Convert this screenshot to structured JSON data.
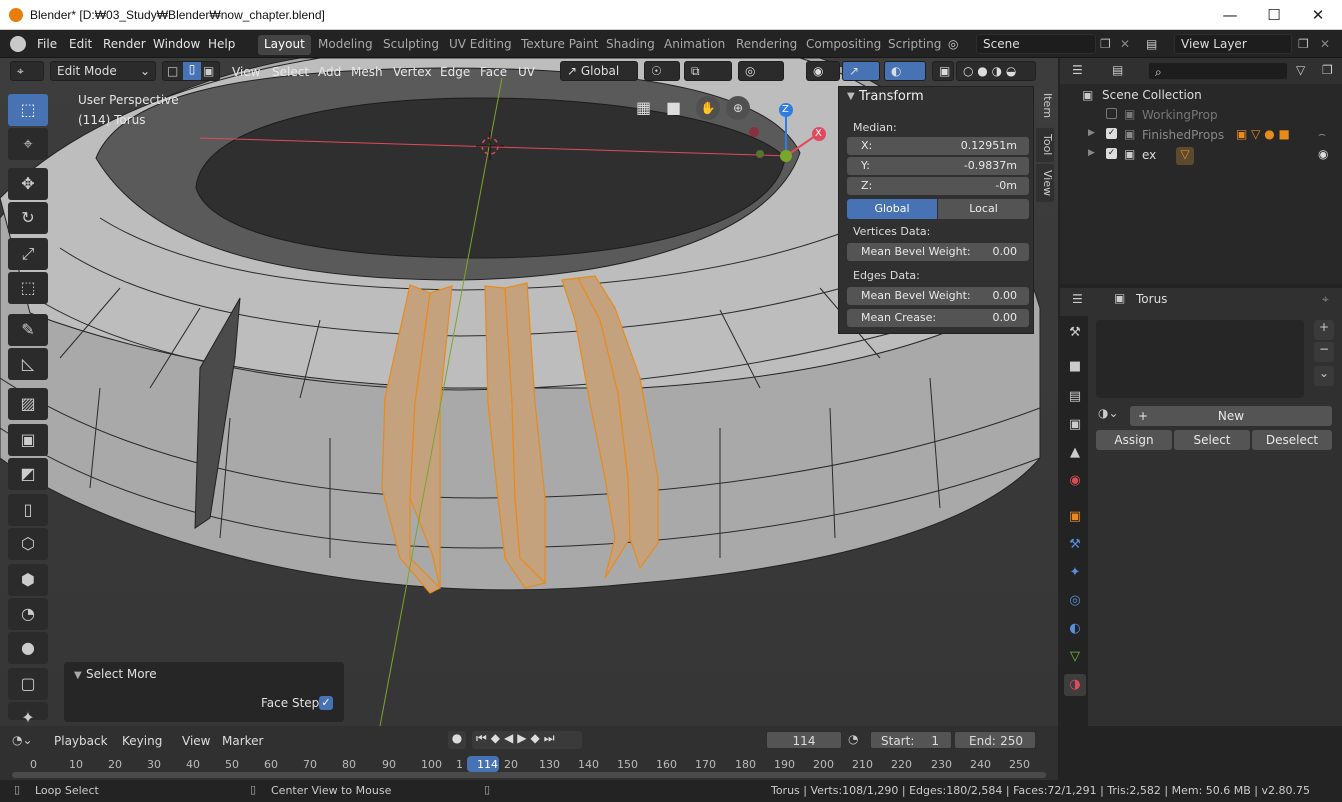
{
  "window": {
    "title": "Blender* [D:₩03_Study₩Blender₩now_chapter.blend]",
    "min": "—",
    "max": "☐",
    "close": "✕"
  },
  "menus": [
    "File",
    "Edit",
    "Render",
    "Window",
    "Help"
  ],
  "workspaces": [
    "Layout",
    "Modeling",
    "Sculpting",
    "UV Editing",
    "Texture Paint",
    "Shading",
    "Animation",
    "Rendering",
    "Compositing",
    "Scripting"
  ],
  "active_workspace": "Layout",
  "scene": {
    "name": "Scene",
    "view_layer": "View Layer"
  },
  "viewport_header": {
    "mode": "Edit Mode",
    "menus": [
      "View",
      "Select",
      "Add",
      "Mesh",
      "Vertex",
      "Edge",
      "Face",
      "UV"
    ],
    "orientation": "Global"
  },
  "viewport": {
    "perspective": "User Perspective",
    "object_info": "(114) Torus"
  },
  "gizmo": {
    "z": "Z",
    "x": "X"
  },
  "transform_panel": {
    "title": "Transform",
    "median_label": "Median:",
    "fields": [
      {
        "label": "X:",
        "value": "0.12951m"
      },
      {
        "label": "Y:",
        "value": "-0.9837m"
      },
      {
        "label": "Z:",
        "value": "-0m"
      }
    ],
    "global": "Global",
    "local": "Local",
    "vertices_data": "Vertices Data:",
    "v_mean_bevel": {
      "label": "Mean Bevel Weight:",
      "value": "0.00"
    },
    "edges_data": "Edges Data:",
    "e_mean_bevel": {
      "label": "Mean Bevel Weight:",
      "value": "0.00"
    },
    "mean_crease": {
      "label": "Mean Crease:",
      "value": "0.00"
    }
  },
  "side_tabs": [
    "Item",
    "Tool",
    "View"
  ],
  "select_more": {
    "title": "Select More",
    "face_step": "Face Step"
  },
  "outliner": {
    "scene_collection": "Scene Collection",
    "items": [
      {
        "name": "WorkingProp"
      },
      {
        "name": "FinishedProps"
      },
      {
        "name": "ex"
      }
    ]
  },
  "properties": {
    "object": "Torus",
    "new": "New",
    "assign": "Assign",
    "select": "Select",
    "deselect": "Deselect"
  },
  "timeline": {
    "menus": [
      "Playback",
      "Keying",
      "View",
      "Marker"
    ],
    "current_frame": "114",
    "start_label": "Start:",
    "start": "1",
    "end_label": "End:",
    "end": "250",
    "ticks": [
      "0",
      "10",
      "20",
      "30",
      "40",
      "50",
      "60",
      "70",
      "80",
      "90",
      "100",
      "1",
      "114",
      "20",
      "130",
      "140",
      "150",
      "160",
      "170",
      "180",
      "190",
      "200",
      "210",
      "220",
      "230",
      "240",
      "250"
    ]
  },
  "statusbar": {
    "left": "Loop Select",
    "center": "Center View to Mouse",
    "right": "Torus | Verts:108/1,290 | Edges:180/2,584 | Faces:72/1,291 | Tris:2,582 | Mem: 50.6 MB | v2.80.75"
  },
  "colors": {
    "accent": "#4772b3",
    "select": "#e88a1c",
    "axis_x": "#e04a5c",
    "axis_y": "#79a62b",
    "axis_z": "#2f7de1"
  }
}
